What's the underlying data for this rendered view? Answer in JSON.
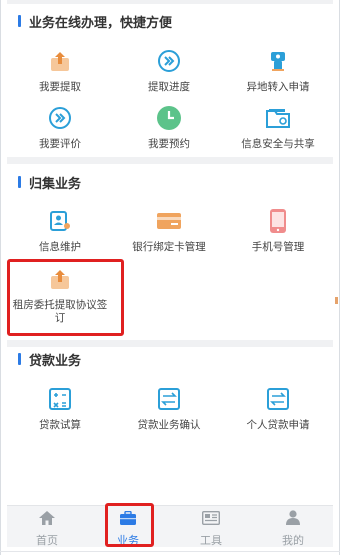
{
  "sections": [
    {
      "title": "业务在线办理，快捷方便",
      "items": [
        {
          "label": "我要提取",
          "icon": "upload-icon"
        },
        {
          "label": "提取进度",
          "icon": "chevrons-right-icon"
        },
        {
          "label": "异地转入申请",
          "icon": "transfer-icon"
        },
        {
          "label": "我要评价",
          "icon": "chevrons-right-icon"
        },
        {
          "label": "我要预约",
          "icon": "clock-icon"
        },
        {
          "label": "信息安全与共享",
          "icon": "folder-lock-icon"
        }
      ]
    },
    {
      "title": "归集业务",
      "items": [
        {
          "label": "信息维护",
          "icon": "id-card-icon"
        },
        {
          "label": "银行绑定卡管理",
          "icon": "bank-card-icon"
        },
        {
          "label": "手机号管理",
          "icon": "phone-icon"
        },
        {
          "label": "租房委托提取协议签订",
          "icon": "upload-icon"
        }
      ]
    },
    {
      "title": "贷款业务",
      "items": [
        {
          "label": "贷款试算",
          "icon": "calculator-icon"
        },
        {
          "label": "贷款业务确认",
          "icon": "exchange-icon"
        },
        {
          "label": "个人贷款申请",
          "icon": "exchange-icon"
        }
      ]
    }
  ],
  "tabs": [
    {
      "label": "首页",
      "icon": "home-icon",
      "active": false
    },
    {
      "label": "业务",
      "icon": "briefcase-icon",
      "active": true
    },
    {
      "label": "工具",
      "icon": "newspaper-icon",
      "active": false
    },
    {
      "label": "我的",
      "icon": "user-icon",
      "active": false
    }
  ],
  "colors": {
    "accent_blue": "#2c7be5",
    "orange": "#f0a45e",
    "teal": "#2b9fd8",
    "green": "#5cc38a",
    "pink": "#f08c8c",
    "highlight_red": "#e02020"
  }
}
